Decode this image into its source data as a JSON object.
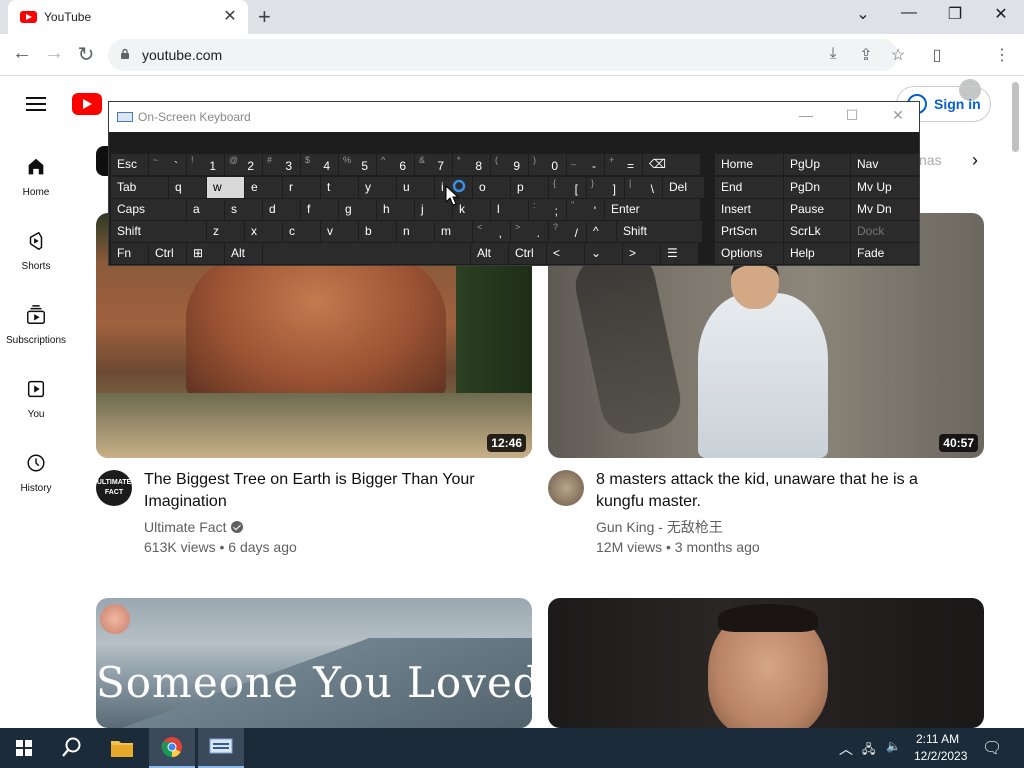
{
  "browser": {
    "tab_title": "YouTube",
    "tab_close": "✕",
    "new_tab": "+",
    "url": "youtube.com",
    "window_controls": {
      "dropdown": "⌄",
      "minimize": "—",
      "restore": "❐",
      "close": "✕"
    }
  },
  "youtube": {
    "sign_in": "Sign in",
    "sidebar": [
      {
        "label": "Home",
        "icon": "home-icon"
      },
      {
        "label": "Shorts",
        "icon": "shorts-icon"
      },
      {
        "label": "Subscriptions",
        "icon": "subscriptions-icon"
      },
      {
        "label": "You",
        "icon": "you-icon"
      },
      {
        "label": "History",
        "icon": "history-icon"
      }
    ],
    "chip_fragment": "nas",
    "videos": [
      {
        "title": "The Biggest Tree on Earth is Bigger Than Your Imagination",
        "channel": "Ultimate Fact",
        "verified": true,
        "meta": "613K views • 6 days ago",
        "duration": "12:46",
        "avatar_text": "ULTIMATE FACT"
      },
      {
        "title": "8 masters attack the kid, unaware that he is a kungfu master.",
        "channel": "Gun King - 无敌枪王",
        "verified": false,
        "meta": "12M views • 3 months ago",
        "duration": "40:57"
      },
      {
        "thumbnail_text": "Someone You Loved"
      },
      {}
    ]
  },
  "osk": {
    "title": "On-Screen Keyboard",
    "rows": [
      [
        {
          "m": "Esc"
        },
        {
          "m": "`",
          "s": "~"
        },
        {
          "m": "1",
          "s": "!"
        },
        {
          "m": "2",
          "s": "@"
        },
        {
          "m": "3",
          "s": "#"
        },
        {
          "m": "4",
          "s": "$"
        },
        {
          "m": "5",
          "s": "%"
        },
        {
          "m": "6",
          "s": "^"
        },
        {
          "m": "7",
          "s": "&"
        },
        {
          "m": "8",
          "s": "*"
        },
        {
          "m": "9",
          "s": "("
        },
        {
          "m": "0",
          "s": ")"
        },
        {
          "m": "-",
          "s": "_"
        },
        {
          "m": "=",
          "s": "+"
        },
        {
          "m": "⌫"
        }
      ],
      [
        {
          "m": "Tab"
        },
        {
          "m": "q"
        },
        {
          "m": "w"
        },
        {
          "m": "e"
        },
        {
          "m": "r"
        },
        {
          "m": "t"
        },
        {
          "m": "y"
        },
        {
          "m": "u"
        },
        {
          "m": "i"
        },
        {
          "m": "o"
        },
        {
          "m": "p"
        },
        {
          "m": "[",
          "s": "{"
        },
        {
          "m": "]",
          "s": "}"
        },
        {
          "m": "\\",
          "s": "|"
        },
        {
          "m": "Del"
        }
      ],
      [
        {
          "m": "Caps"
        },
        {
          "m": "a"
        },
        {
          "m": "s"
        },
        {
          "m": "d"
        },
        {
          "m": "f"
        },
        {
          "m": "g"
        },
        {
          "m": "h"
        },
        {
          "m": "j"
        },
        {
          "m": "k"
        },
        {
          "m": "l"
        },
        {
          "m": ";",
          "s": ":"
        },
        {
          "m": "'",
          "s": "\""
        },
        {
          "m": "Enter"
        }
      ],
      [
        {
          "m": "Shift"
        },
        {
          "m": "z"
        },
        {
          "m": "x"
        },
        {
          "m": "c"
        },
        {
          "m": "v"
        },
        {
          "m": "b"
        },
        {
          "m": "n"
        },
        {
          "m": "m"
        },
        {
          "m": ",",
          "s": "<"
        },
        {
          "m": ".",
          "s": ">"
        },
        {
          "m": "/",
          "s": "?"
        },
        {
          "m": "^"
        },
        {
          "m": "Shift"
        }
      ],
      [
        {
          "m": "Fn"
        },
        {
          "m": "Ctrl"
        },
        {
          "m": "⊞"
        },
        {
          "m": "Alt"
        },
        {
          "m": ""
        },
        {
          "m": "Alt"
        },
        {
          "m": "Ctrl"
        },
        {
          "m": "<"
        },
        {
          "m": "⌄"
        },
        {
          "m": ">"
        },
        {
          "m": "☰"
        }
      ]
    ],
    "nav": [
      [
        "Home",
        "PgUp",
        "Nav"
      ],
      [
        "End",
        "PgDn",
        "Mv Up"
      ],
      [
        "Insert",
        "Pause",
        "Mv Dn"
      ],
      [
        "PrtScn",
        "ScrLk",
        "Dock"
      ],
      [
        "Options",
        "Help",
        "Fade"
      ]
    ]
  },
  "taskbar": {
    "time": "2:11 AM",
    "date": "12/2/2023"
  }
}
